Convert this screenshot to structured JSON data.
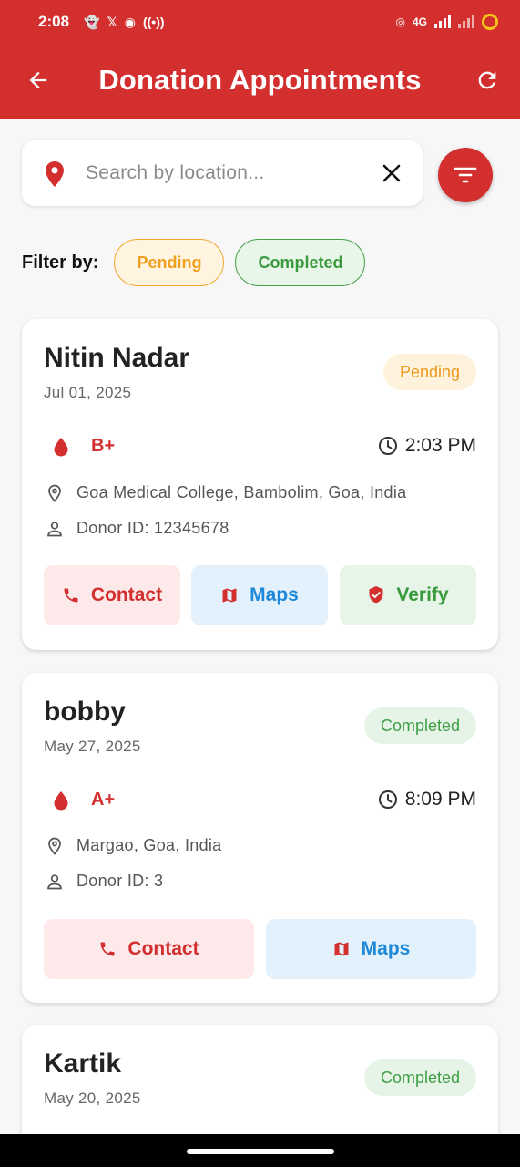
{
  "status_bar": {
    "time": "2:08",
    "network": "4G"
  },
  "app_bar": {
    "title": "Donation Appointments"
  },
  "search": {
    "placeholder": "Search by location..."
  },
  "filter": {
    "label": "Filter by:",
    "chips": [
      "Pending",
      "Completed"
    ]
  },
  "appointments": [
    {
      "name": "Nitin Nadar",
      "date": "Jul 01, 2025",
      "status": "Pending",
      "blood_type": "B+",
      "time": "2:03 PM",
      "location": "Goa Medical College, Bambolim, Goa, India",
      "donor_id": "Donor ID: 12345678",
      "buttons": [
        "Contact",
        "Maps",
        "Verify"
      ]
    },
    {
      "name": "bobby",
      "date": "May 27, 2025",
      "status": "Completed",
      "blood_type": "A+",
      "time": "8:09 PM",
      "location": "Margao, Goa, India",
      "donor_id": "Donor ID: 3",
      "buttons": [
        "Contact",
        "Maps"
      ]
    },
    {
      "name": "Kartik",
      "date": "May 20, 2025",
      "status": "Completed"
    }
  ],
  "colors": {
    "primary": "#d32f2f",
    "pending": "#f0a020",
    "completed": "#3a9a3e",
    "maps": "#1e88d8"
  },
  "icons": [
    "back-arrow-icon",
    "refresh-icon",
    "location-pin-icon",
    "close-icon",
    "filter-icon",
    "blood-drop-icon",
    "clock-icon",
    "person-icon",
    "phone-icon",
    "map-icon",
    "verified-shield-icon"
  ]
}
